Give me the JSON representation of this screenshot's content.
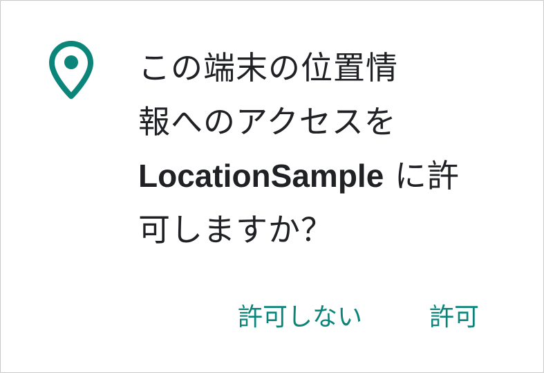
{
  "dialog": {
    "icon": "location-pin-icon",
    "accent_color": "#0b8479",
    "message_prefix_line1": "この端末の位置情",
    "message_prefix_line2": "報へのアクセスを",
    "app_name": "LocationSample",
    "message_suffix_line3": " に許",
    "message_suffix_line4": "可しますか？",
    "deny_label": "許可しない",
    "allow_label": "許可"
  }
}
